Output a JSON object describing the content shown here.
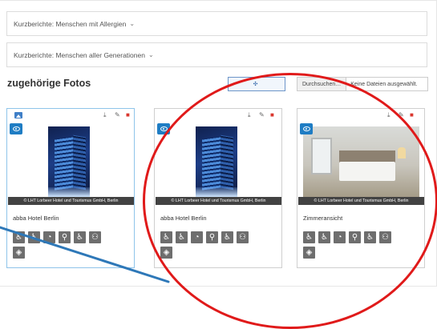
{
  "accordions": [
    {
      "label": "Kurzberichte: Menschen mit Allergien"
    },
    {
      "label": "Kurzberichte: Menschen aller Generationen"
    }
  ],
  "photos_section": {
    "title": "zugehörige Fotos",
    "add_button_label": "",
    "file_button_label": "Durchsuchen…",
    "file_status": "Keine Dateien ausgewählt."
  },
  "cards": [
    {
      "title": "abba Hotel Berlin",
      "caption": "© LHT Lorbeer Hotel und Tourismus GmbH, Berlin",
      "image": "hotel-exterior"
    },
    {
      "title": "abba Hotel Berlin",
      "caption": "© LHT Lorbeer Hotel und Tourismus GmbH, Berlin",
      "image": "hotel-exterior"
    },
    {
      "title": "Zimmeransicht",
      "caption": "© LHT Lorbeer Hotel und Tourismus GmbH, Berlin",
      "image": "hotel-room"
    }
  ],
  "accessibility_icons": [
    "walking-aid-icon",
    "wheelchair-icon",
    "hearing-impaired-icon",
    "blind-cane-icon",
    "wheelchair-user-icon",
    "family-icon",
    "visually-impaired-icon"
  ],
  "colors": {
    "accent_blue": "#1f7dc4",
    "delete_red": "#d9372f",
    "highlight_red": "#e01a1a",
    "pointer_blue": "#2e78b8"
  }
}
